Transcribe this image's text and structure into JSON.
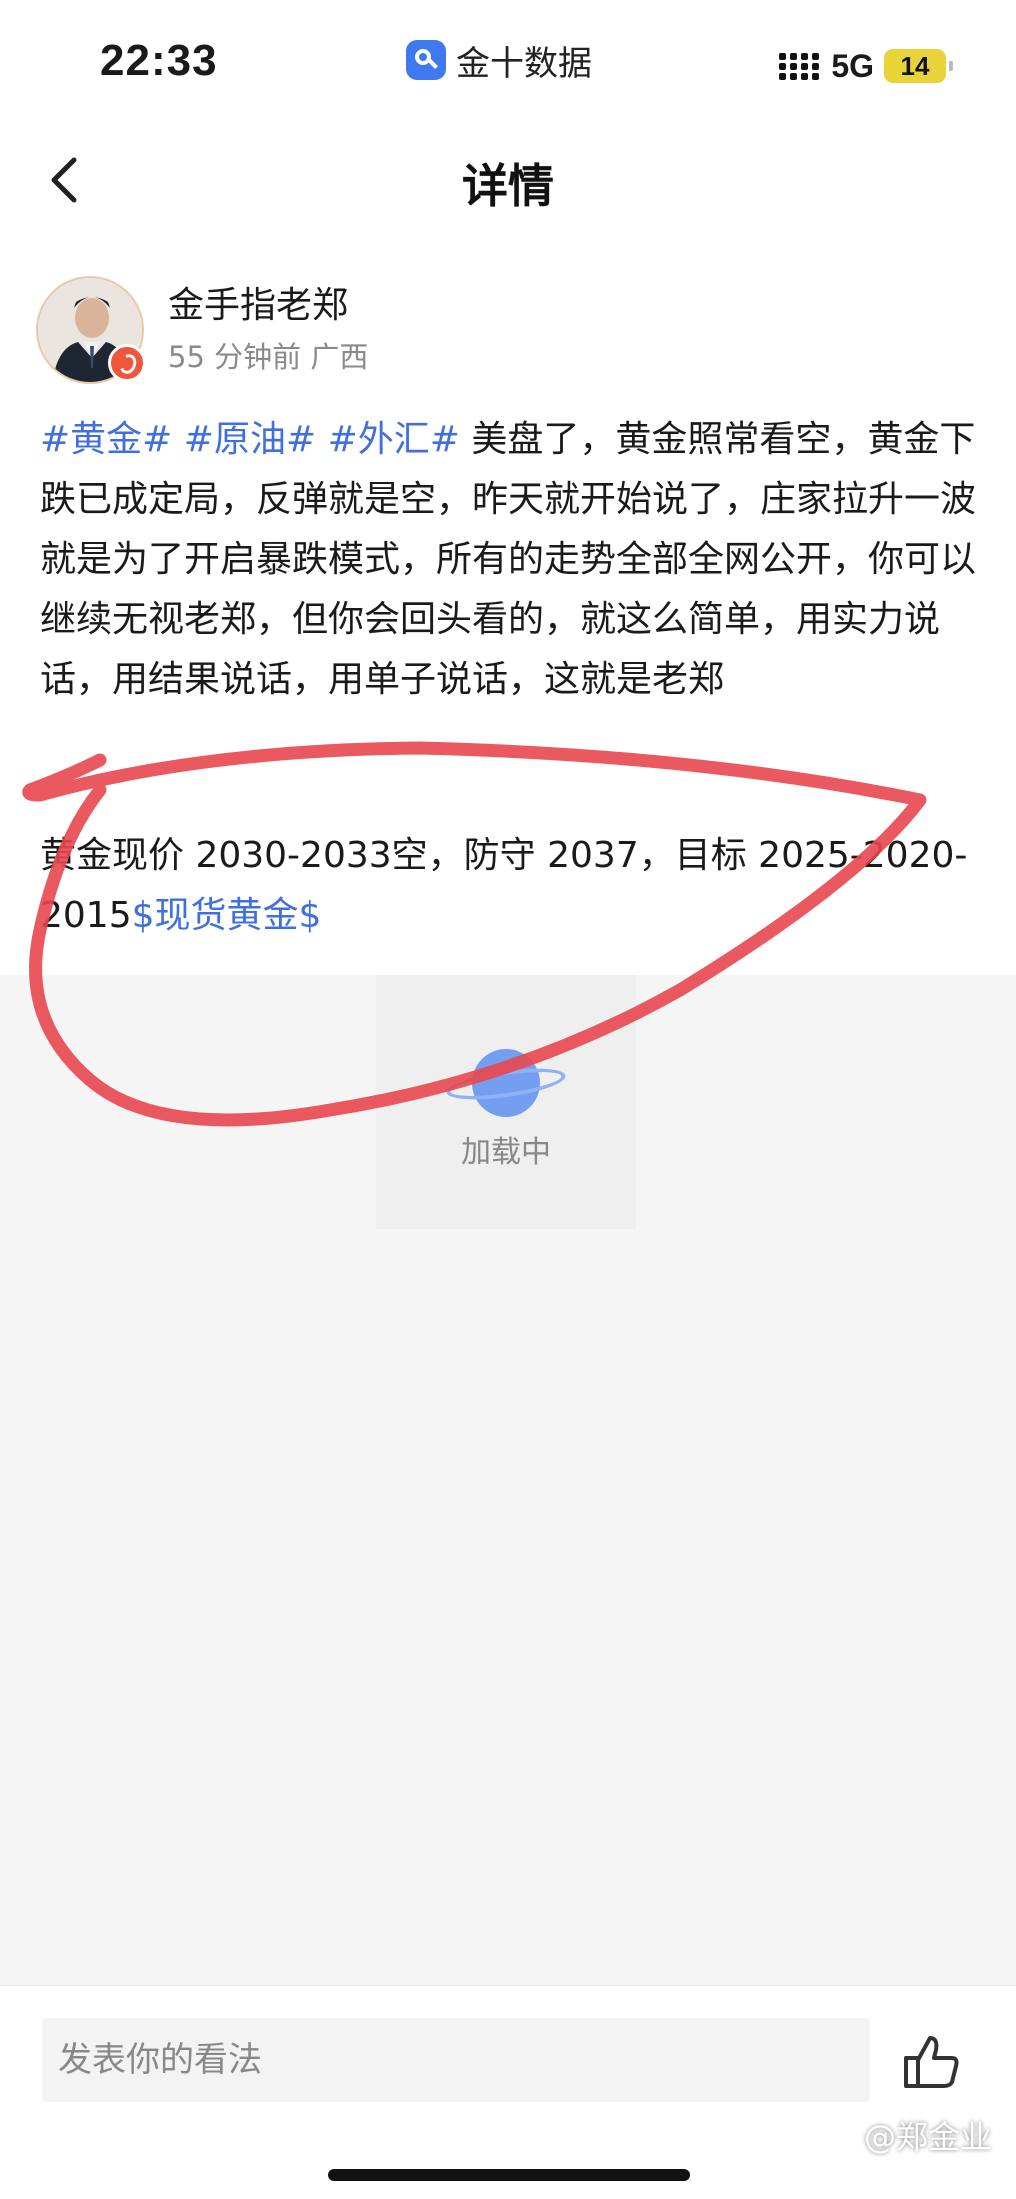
{
  "status_bar": {
    "time": "22:33",
    "app_name": "金十数据",
    "network": "5G",
    "battery": "14"
  },
  "nav": {
    "title": "详情",
    "back_icon": "chevron-left-icon"
  },
  "post": {
    "author_name": "金手指老郑",
    "time_ago": "55 分钟前",
    "location": "广西",
    "tags": [
      "#黄金#",
      "#原油#",
      "#外汇#"
    ],
    "content": "美盘了，黄金照常看空，黄金下跌已成定局，反弹就是空，昨天就开始说了，庄家拉升一波就是为了开启暴跌模式，所有的走势全部全网公开，你可以继续无视老郑，但你会回头看的，就这么简单，用实力说话，用结果说话，用单子说话，这就是老郑",
    "trade_line": "黄金现价 2030-2033空，防守 2037，目标 2025-2020-2015",
    "instrument_tag": "$现货黄金$"
  },
  "loading": {
    "text": "加载中"
  },
  "comment_bar": {
    "placeholder": "发表你的看法",
    "like_icon": "thumbs-up-icon"
  },
  "watermark": "@郑金业",
  "colors": {
    "tag_blue": "#3f6fe0",
    "annotation_red": "#e8474f",
    "battery_yellow": "#e8d338"
  }
}
